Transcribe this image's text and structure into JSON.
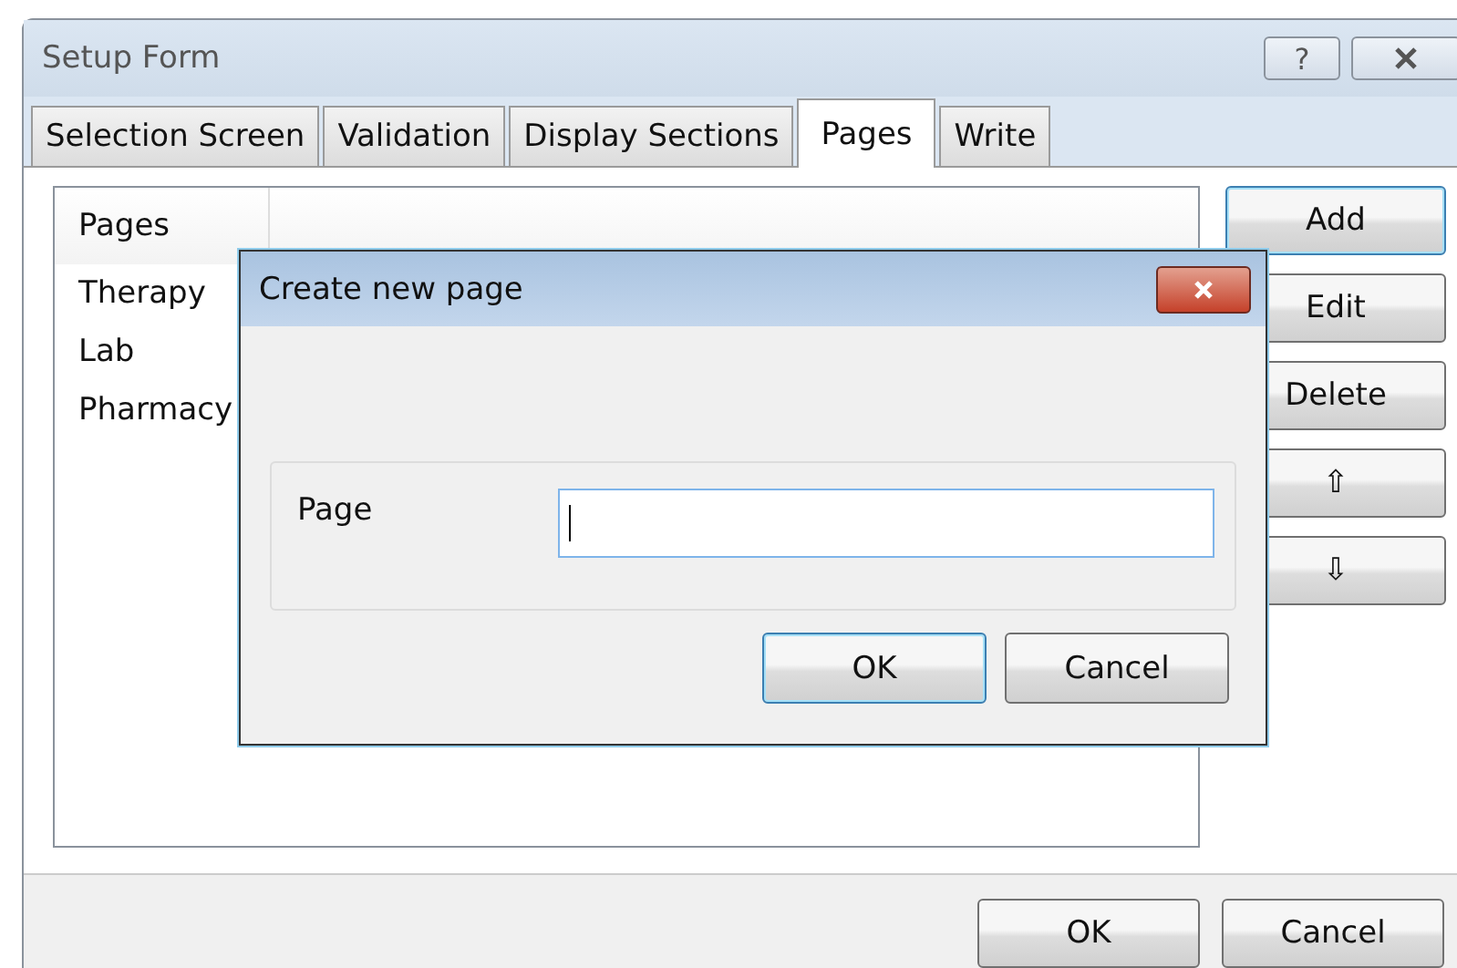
{
  "window": {
    "title": "Setup Form",
    "help_button": "?"
  },
  "tabs": [
    {
      "label": "Selection Screen",
      "selected": false
    },
    {
      "label": "Validation",
      "selected": false
    },
    {
      "label": "Display Sections",
      "selected": false
    },
    {
      "label": "Pages",
      "selected": true
    },
    {
      "label": "Write",
      "selected": false
    }
  ],
  "pages_list": {
    "column": "Pages",
    "items": [
      "Therapy",
      "Lab",
      "Pharmacy"
    ]
  },
  "side_buttons": [
    {
      "label": "Add",
      "focused": true
    },
    {
      "label": "Edit",
      "focused": false
    },
    {
      "label": "Delete",
      "focused": false
    },
    {
      "label": "⇧",
      "focused": false
    },
    {
      "label": "⇩",
      "focused": false
    }
  ],
  "buttons": [
    "OK",
    "Cancel"
  ],
  "dialog": {
    "title": "Create new page",
    "field_label": "Page",
    "buttons": [
      {
        "label": "OK",
        "focused": true
      },
      {
        "label": "Cancel",
        "focused": false
      }
    ]
  }
}
